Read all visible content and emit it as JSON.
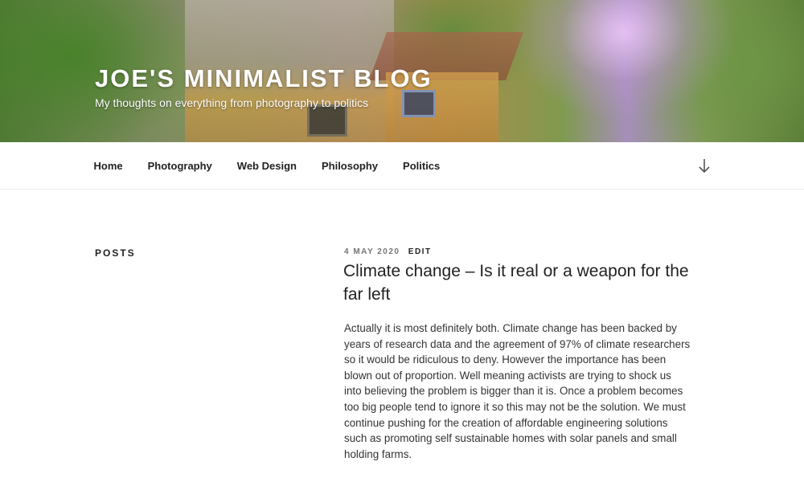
{
  "header": {
    "site_title": "Joe's Minimalist Blog",
    "tagline": "My thoughts on everything from photography to politics"
  },
  "nav": {
    "items": [
      {
        "label": "Home"
      },
      {
        "label": "Photography"
      },
      {
        "label": "Web Design"
      },
      {
        "label": "Philosophy"
      },
      {
        "label": "Politics"
      }
    ],
    "scroll_icon": "arrow-down-icon"
  },
  "sidebar": {
    "heading": "Posts"
  },
  "post": {
    "date": "4 May 2020",
    "edit_label": "Edit",
    "title": "Climate change – Is it real or a weapon for the far left",
    "paragraphs": [
      "Actually it is most definitely both. Climate change has been backed by years of research data and the agreement of 97% of climate researchers so it would be ridiculous to deny. However the importance has been blown out of proportion. Well meaning activists are trying to shock us into believing the problem is bigger than it is. Once a problem becomes too big people tend to ignore it so this may not be the solution. We must continue pushing for the creation of affordable engineering solutions such as promoting self sustainable homes with solar panels and small holding farms."
    ]
  },
  "colors": {
    "background": "#ffffff",
    "text": "#222222",
    "meta_date": "#767676"
  }
}
